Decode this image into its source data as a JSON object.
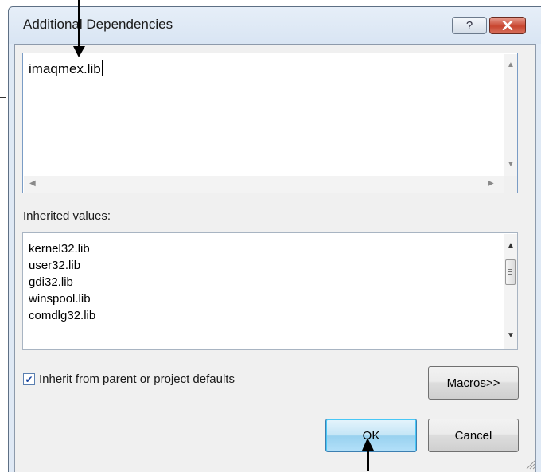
{
  "window": {
    "title": "Additional Dependencies",
    "help_label": "?"
  },
  "editor": {
    "value": "imaqmex.lib"
  },
  "inherited": {
    "label": "Inherited values:",
    "items": [
      "kernel32.lib",
      "user32.lib",
      "gdi32.lib",
      "winspool.lib",
      "comdlg32.lib"
    ]
  },
  "checkbox": {
    "label": "Inherit from parent or project defaults",
    "checked": true
  },
  "buttons": {
    "macros": "Macros>>",
    "ok": "OK",
    "cancel": "Cancel"
  }
}
